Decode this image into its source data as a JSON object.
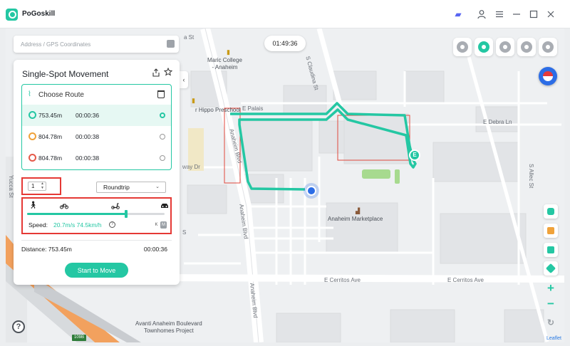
{
  "app": {
    "title": "PoGoskill"
  },
  "search": {
    "placeholder": "Address / GPS Coordinates"
  },
  "timer": "01:49:36",
  "panel": {
    "title": "Single-Spot Movement",
    "choose_route_label": "Choose Route",
    "routes": [
      {
        "distance": "753.45m",
        "duration": "00:00:36",
        "color": "#24c7a3",
        "selected": true
      },
      {
        "distance": "804.78m",
        "duration": "00:00:38",
        "color": "#f0a23a",
        "selected": false
      },
      {
        "distance": "804.78m",
        "duration": "00:00:38",
        "color": "#e55a4a",
        "selected": false
      }
    ],
    "count": "1",
    "mode_select": "Roundtrip",
    "speed_label": "Speed:",
    "speed_value": "20.7m/s 74.5km/h",
    "speed_level": 0.72,
    "unit_k": "K",
    "unit_m": "M",
    "distance_label": "Distance: 753.45m",
    "duration_label": "00:00:36",
    "start_button": "Start to Move"
  },
  "map": {
    "labels": {
      "maric_college": "Maric College\n- Anaheim",
      "claudina": "S Claudina St",
      "hippo": "r Hippo Preschool",
      "e_palais": "E Palais",
      "e_debra": "E Debra Ln",
      "way_dr": "way Dr",
      "s_allec": "S Allec St",
      "anaheim_blvd_1": "Anaheim Blvd",
      "anaheim_blvd_2": "Anaheim Blvd",
      "anaheim_blvd_3": "Anaheim Blvd",
      "marketplace": "Anaheim Marketplace",
      "e_cerritos_1": "E Cerritos Ave",
      "e_cerritos_2": "E Cerritos Ave",
      "avanti": "Avanti Anaheim Boulevard\nTownhomes Project",
      "yucca": "Yucca St",
      "a_st": "a St",
      "s_st": "S",
      "road_109b": "109B",
      "leaflet": "Leaflet"
    }
  },
  "colors": {
    "accent": "#24c7a3",
    "highlight": "#e53935"
  },
  "icons": [
    "discord-icon",
    "user-icon",
    "menu-icon",
    "minimize-icon",
    "maximize-icon",
    "close-icon"
  ]
}
